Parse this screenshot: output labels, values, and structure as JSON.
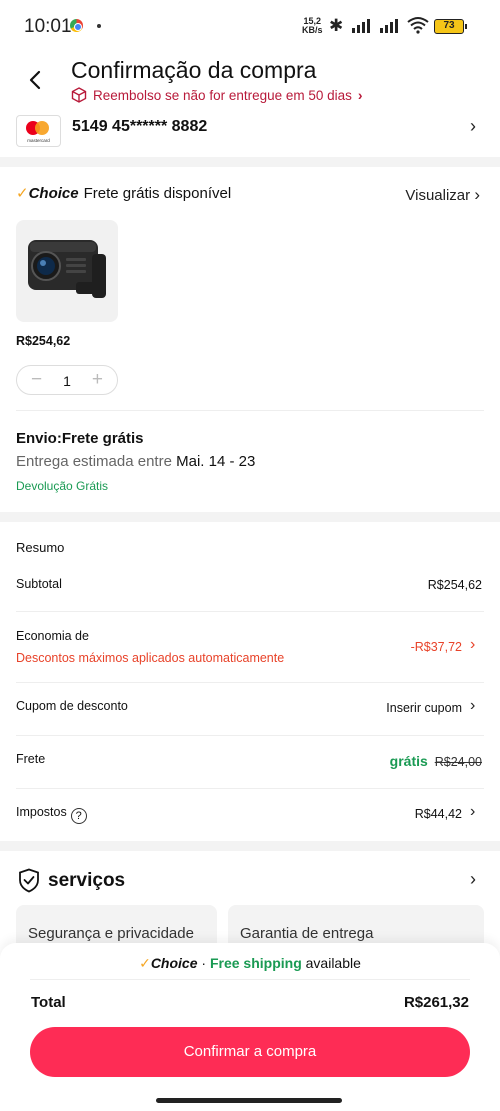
{
  "status_bar": {
    "time": "10:01",
    "net_speed_value": "15,2",
    "net_speed_unit": "KB/s",
    "battery": "73"
  },
  "header": {
    "title": "Confirmação da compra",
    "refund_text": "Reembolso se não for entregue em 50 dias"
  },
  "payment": {
    "card_brand_text": "mastercard",
    "card_number": "5149 45****** 8882"
  },
  "choice": {
    "logo": "Choice",
    "label": "Frete grátis disponível",
    "view_label": "Visualizar"
  },
  "product": {
    "price": "R$254,62",
    "quantity": "1"
  },
  "shipping": {
    "title": "Envio:Frete grátis",
    "estimate_prefix": "Entrega estimada entre",
    "estimate_dates": "Mai. 14 - 23",
    "return_text": "Devolução Grátis"
  },
  "summary": {
    "title": "Resumo",
    "subtotal_label": "Subtotal",
    "subtotal_value": "R$254,62",
    "savings_label": "Economia de",
    "savings_note": "Descontos máximos aplicados automaticamente",
    "savings_value": "-R$37,72",
    "coupon_label": "Cupom de desconto",
    "coupon_action": "Inserir cupom",
    "shipping_label": "Frete",
    "shipping_free": "grátis",
    "shipping_old": "R$24,00",
    "taxes_label": "Impostos",
    "taxes_value": "R$44,42"
  },
  "services": {
    "title": "serviços",
    "cards": [
      "Segurança e privacidade",
      "Garantia de entrega"
    ]
  },
  "bottom": {
    "promo_choice": "Choice",
    "promo_separator": " · ",
    "promo_green": "Free shipping",
    "promo_rest": " available",
    "total_label": "Total",
    "total_value": "R$261,32",
    "confirm_label": "Confirmar a compra"
  },
  "colors": {
    "accent": "#fe2c55",
    "green": "#1a9a53",
    "discount_red": "#e8432a",
    "refund_red": "#b81a3a",
    "choice_check": "#f5a623"
  },
  "icons": [
    "back-arrow-icon",
    "refund-box-icon",
    "chevron-right-icon",
    "shield-check-icon",
    "help-icon",
    "mastercard-logo",
    "minus-icon",
    "plus-icon"
  ]
}
